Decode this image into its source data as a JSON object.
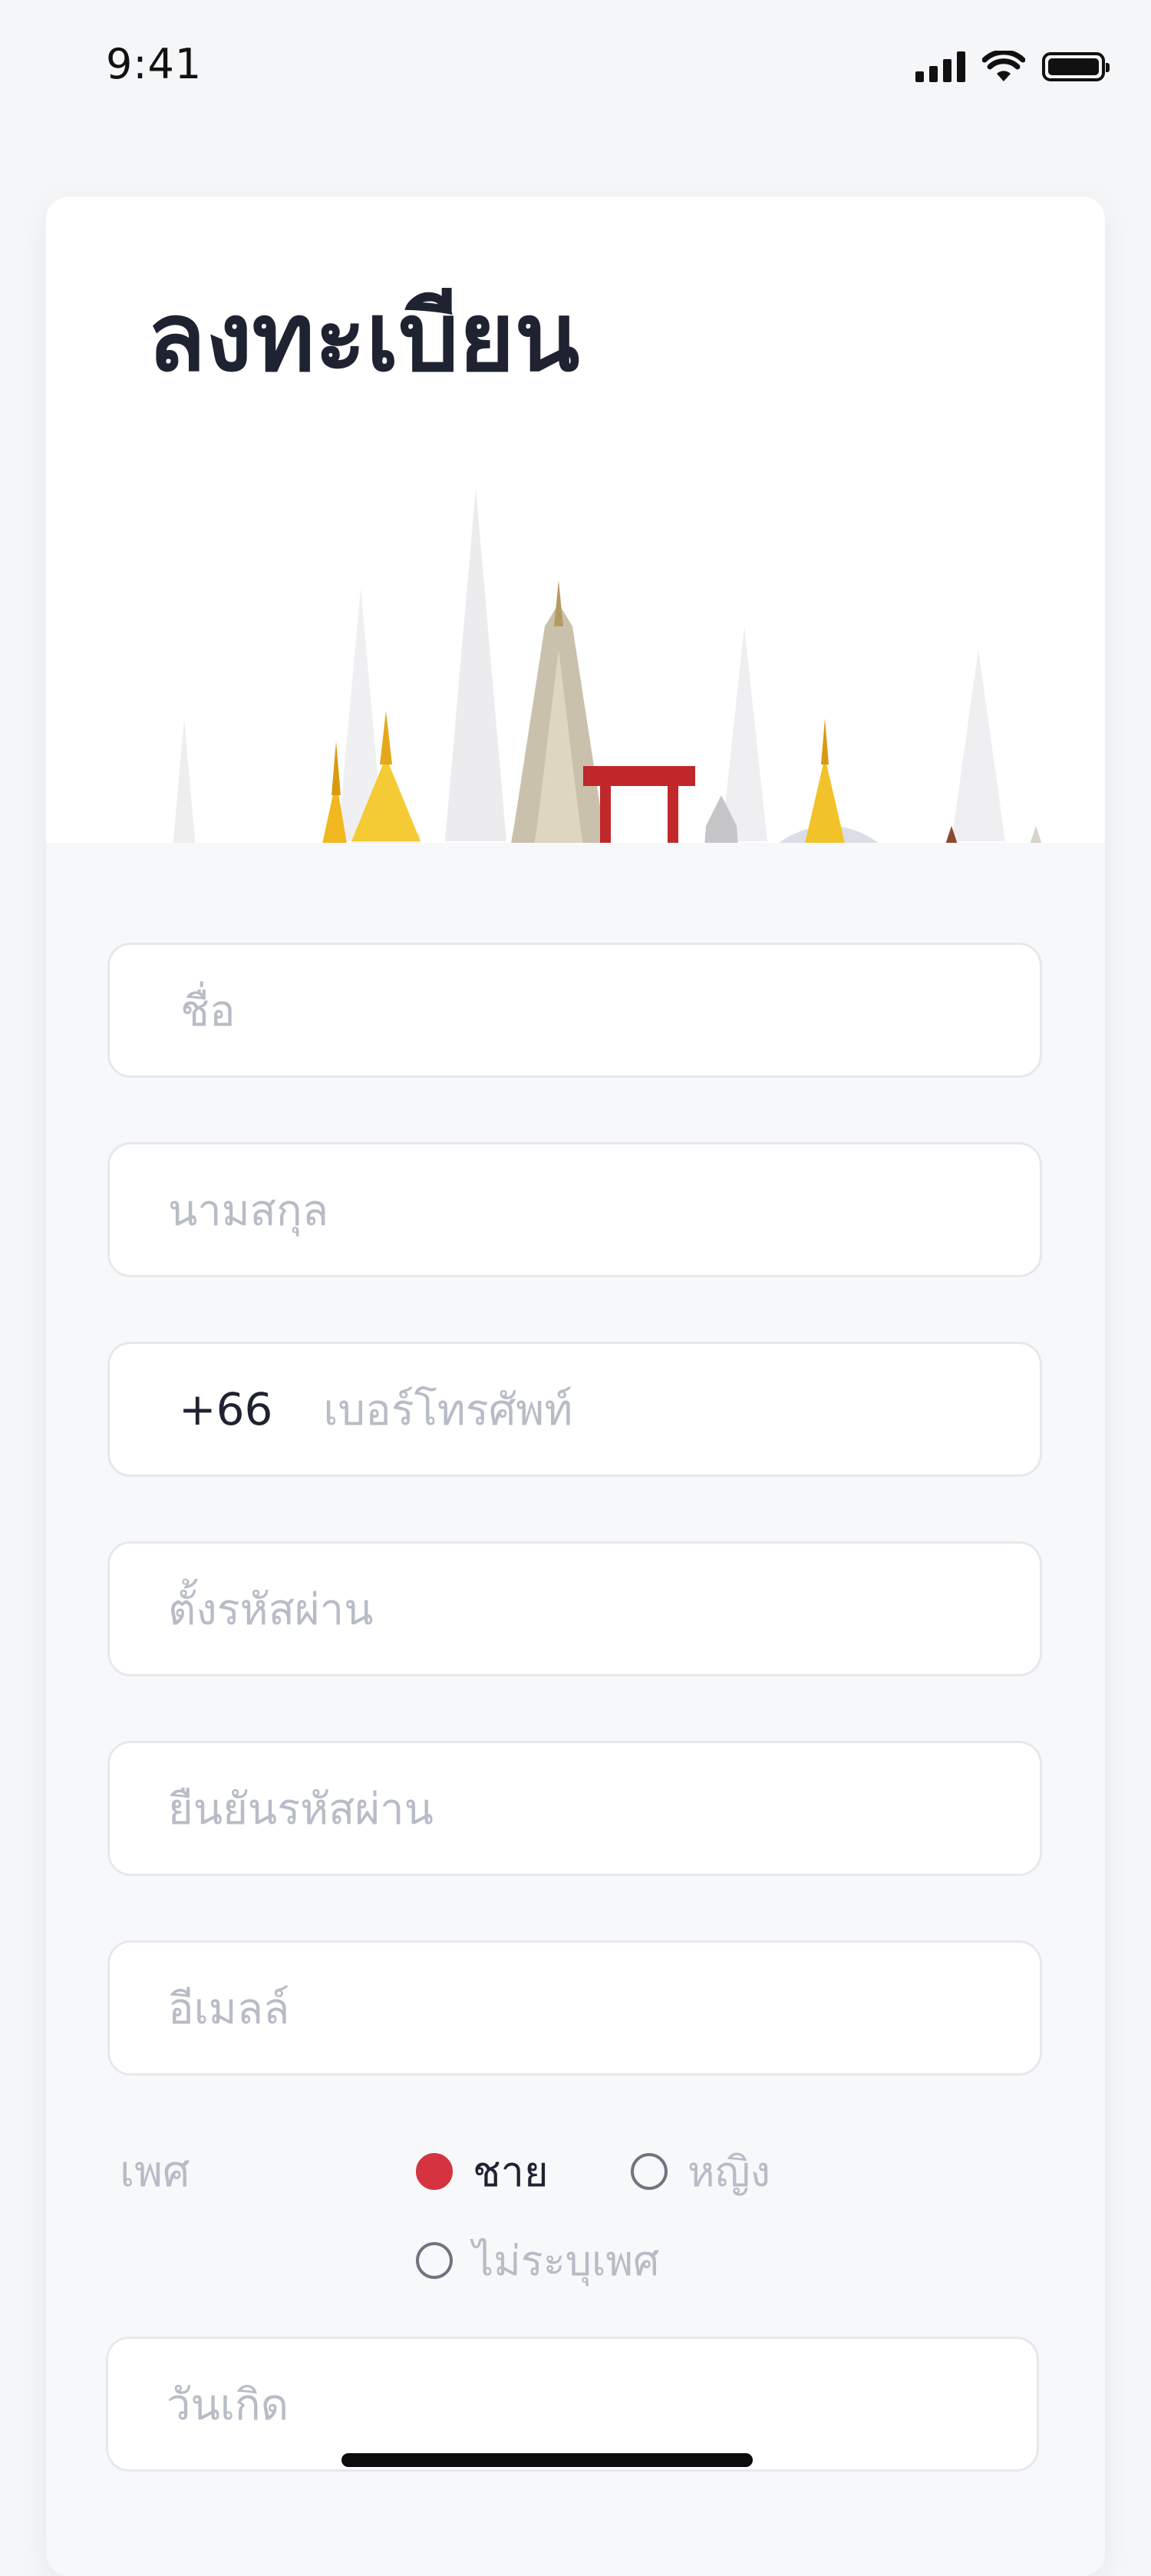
{
  "status": {
    "time": "9:41"
  },
  "page": {
    "title": "ลงทะเบียน"
  },
  "form": {
    "first_name_placeholder": "ชื่อ",
    "last_name_placeholder": "นามสกุล",
    "country_code": "+66",
    "phone_placeholder": "เบอร์โทรศัพท์",
    "password_placeholder": "ตั้งรหัสผ่าน",
    "confirm_password_placeholder": "ยืนยันรหัสผ่าน",
    "email_placeholder": "อีเมลล์",
    "gender": {
      "label": "เพศ",
      "options": [
        {
          "label": "ชาย",
          "selected": true
        },
        {
          "label": "หญิง",
          "selected": false
        },
        {
          "label": "ไม่ระบุเพศ",
          "selected": false
        }
      ]
    },
    "birthdate_placeholder": "วันเกิด"
  },
  "colors": {
    "accent": "#d63340",
    "title": "#1f2331",
    "placeholder": "#b8bcc6"
  }
}
